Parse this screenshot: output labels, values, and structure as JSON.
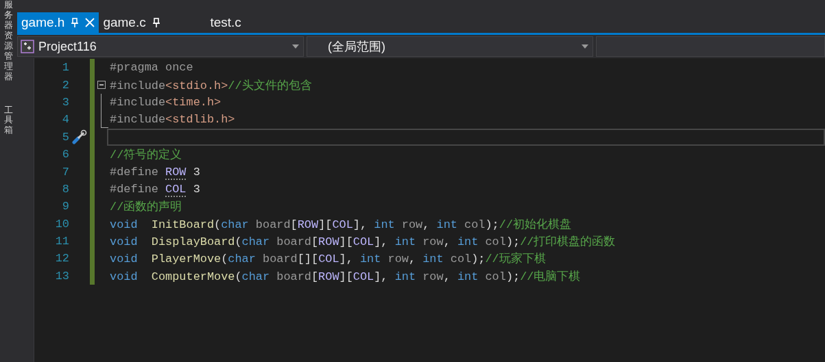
{
  "side_panels": [
    {
      "label": "服务器资源管理器"
    },
    {
      "label": "工具箱"
    }
  ],
  "tabs": [
    {
      "label": "game.h",
      "selected": true,
      "pinned": true
    },
    {
      "label": "game.c",
      "selected": false,
      "pinned": true
    },
    {
      "label": "test.c",
      "selected": false,
      "pinned": false
    }
  ],
  "nav_bar": {
    "project": "Project116",
    "scope": "(全局范围)"
  },
  "editor": {
    "lines": [
      {
        "number": "1",
        "changed": true,
        "current": false,
        "quick_action": false,
        "segments": [
          {
            "kind": "preproc",
            "text": "#pragma once"
          }
        ]
      },
      {
        "number": "2",
        "changed": true,
        "current": false,
        "fold": {
          "kind": "start"
        },
        "quick_action": false,
        "segments": [
          {
            "kind": "preproc",
            "text": "#include"
          },
          {
            "kind": "string",
            "text": "<stdio.h>"
          },
          {
            "kind": "comment",
            "text": "//头文件的包含"
          }
        ]
      },
      {
        "number": "3",
        "changed": true,
        "current": false,
        "fold": {
          "kind": "inside"
        },
        "quick_action": false,
        "segments": [
          {
            "kind": "preproc",
            "text": "#include"
          },
          {
            "kind": "string",
            "text": "<time.h>"
          }
        ]
      },
      {
        "number": "4",
        "changed": true,
        "current": false,
        "fold": {
          "kind": "end"
        },
        "quick_action": false,
        "segments": [
          {
            "kind": "preproc",
            "text": "#include"
          },
          {
            "kind": "string",
            "text": "<stdlib.h>"
          }
        ]
      },
      {
        "number": "5",
        "changed": true,
        "current": true,
        "quick_action": true
      },
      {
        "number": "6",
        "changed": true,
        "current": false,
        "quick_action": false,
        "segments": [
          {
            "kind": "comment",
            "text": "//符号的定义"
          }
        ]
      },
      {
        "number": "7",
        "changed": true,
        "current": false,
        "quick_action": false,
        "segments": [
          {
            "kind": "preproc",
            "text": "#define "
          },
          {
            "kind": "macro_hint",
            "text": "ROW"
          },
          {
            "kind": "plain",
            "text": " 3"
          }
        ]
      },
      {
        "number": "8",
        "changed": true,
        "current": false,
        "quick_action": false,
        "segments": [
          {
            "kind": "preproc",
            "text": "#define "
          },
          {
            "kind": "macro_hint",
            "text": "COL"
          },
          {
            "kind": "plain",
            "text": " 3"
          }
        ]
      },
      {
        "number": "9",
        "changed": true,
        "current": false,
        "quick_action": false,
        "segments": [
          {
            "kind": "comment",
            "text": "//函数的声明"
          }
        ]
      },
      {
        "number": "10",
        "changed": true,
        "current": false,
        "quick_action": false,
        "segments": [
          {
            "kind": "keyword",
            "text": "void"
          },
          {
            "kind": "function",
            "text": "  InitBoard"
          },
          {
            "kind": "plain",
            "text": "("
          },
          {
            "kind": "keyword",
            "text": "char"
          },
          {
            "kind": "param",
            "text": " board"
          },
          {
            "kind": "plain",
            "text": "["
          },
          {
            "kind": "macro",
            "text": "ROW"
          },
          {
            "kind": "plain",
            "text": "]["
          },
          {
            "kind": "macro",
            "text": "COL"
          },
          {
            "kind": "plain",
            "text": "], "
          },
          {
            "kind": "keyword",
            "text": "int"
          },
          {
            "kind": "param",
            "text": " row"
          },
          {
            "kind": "plain",
            "text": ", "
          },
          {
            "kind": "keyword",
            "text": "int"
          },
          {
            "kind": "param",
            "text": " col"
          },
          {
            "kind": "plain",
            "text": ");"
          },
          {
            "kind": "comment",
            "text": "//初始化棋盘"
          }
        ]
      },
      {
        "number": "11",
        "changed": true,
        "current": false,
        "quick_action": false,
        "segments": [
          {
            "kind": "keyword",
            "text": "void"
          },
          {
            "kind": "function",
            "text": "  DisplayBoard"
          },
          {
            "kind": "plain",
            "text": "("
          },
          {
            "kind": "keyword",
            "text": "char"
          },
          {
            "kind": "param",
            "text": " board"
          },
          {
            "kind": "plain",
            "text": "["
          },
          {
            "kind": "macro",
            "text": "ROW"
          },
          {
            "kind": "plain",
            "text": "]["
          },
          {
            "kind": "macro",
            "text": "COL"
          },
          {
            "kind": "plain",
            "text": "], "
          },
          {
            "kind": "keyword",
            "text": "int"
          },
          {
            "kind": "param",
            "text": " row"
          },
          {
            "kind": "plain",
            "text": ", "
          },
          {
            "kind": "keyword",
            "text": "int"
          },
          {
            "kind": "param",
            "text": " col"
          },
          {
            "kind": "plain",
            "text": ");"
          },
          {
            "kind": "comment",
            "text": "//打印棋盘的函数"
          }
        ]
      },
      {
        "number": "12",
        "changed": true,
        "current": false,
        "quick_action": false,
        "segments": [
          {
            "kind": "keyword",
            "text": "void"
          },
          {
            "kind": "function",
            "text": "  PlayerMove"
          },
          {
            "kind": "plain",
            "text": "("
          },
          {
            "kind": "keyword",
            "text": "char"
          },
          {
            "kind": "param",
            "text": " board"
          },
          {
            "kind": "plain",
            "text": "[]["
          },
          {
            "kind": "macro",
            "text": "COL"
          },
          {
            "kind": "plain",
            "text": "], "
          },
          {
            "kind": "keyword",
            "text": "int"
          },
          {
            "kind": "param",
            "text": " row"
          },
          {
            "kind": "plain",
            "text": ", "
          },
          {
            "kind": "keyword",
            "text": "int"
          },
          {
            "kind": "param",
            "text": " col"
          },
          {
            "kind": "plain",
            "text": ");"
          },
          {
            "kind": "comment",
            "text": "//玩家下棋"
          }
        ]
      },
      {
        "number": "13",
        "changed": true,
        "current": false,
        "quick_action": false,
        "segments": [
          {
            "kind": "keyword",
            "text": "void"
          },
          {
            "kind": "function",
            "text": "  ComputerMove"
          },
          {
            "kind": "plain",
            "text": "("
          },
          {
            "kind": "keyword",
            "text": "char"
          },
          {
            "kind": "param",
            "text": " board"
          },
          {
            "kind": "plain",
            "text": "["
          },
          {
            "kind": "macro",
            "text": "ROW"
          },
          {
            "kind": "plain",
            "text": "]["
          },
          {
            "kind": "macro",
            "text": "COL"
          },
          {
            "kind": "plain",
            "text": "], "
          },
          {
            "kind": "keyword",
            "text": "int"
          },
          {
            "kind": "param",
            "text": " row"
          },
          {
            "kind": "plain",
            "text": ", "
          },
          {
            "kind": "keyword",
            "text": "int"
          },
          {
            "kind": "param",
            "text": " col"
          },
          {
            "kind": "plain",
            "text": ");"
          },
          {
            "kind": "comment",
            "text": "//电脑下棋"
          }
        ]
      }
    ]
  }
}
